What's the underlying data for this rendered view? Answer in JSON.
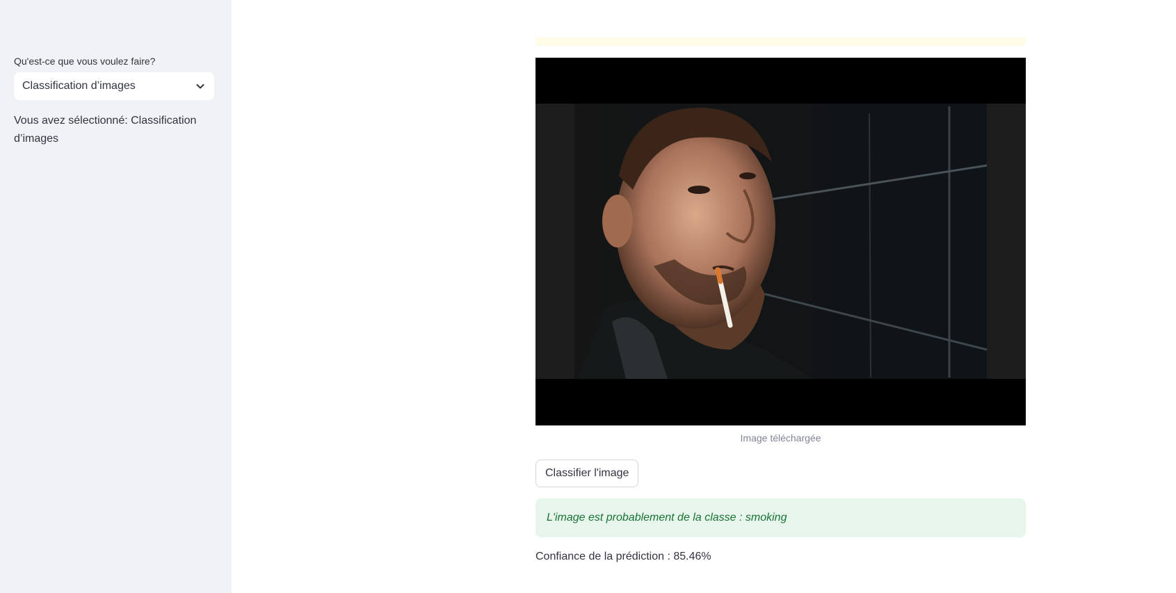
{
  "sidebar": {
    "select_label": "Qu'est-ce que vous voulez faire?",
    "selected_option": "Classification d’images",
    "selection_text": "Vous avez sélectionné: Classification d’images"
  },
  "main": {
    "image_caption": "Image téléchargée",
    "classify_button": "Classifier l'image",
    "result_text": "L'image est probablement de la classe : smoking",
    "confidence_text": "Confiance de la prédiction : 85.46%"
  },
  "icons": {
    "dropdown": "chevron-down-icon"
  },
  "colors": {
    "sidebar_bg": "#f0f2f6",
    "success_bg": "#e8f5ec",
    "success_text": "#177233",
    "warning_strip": "#fffbe6"
  }
}
